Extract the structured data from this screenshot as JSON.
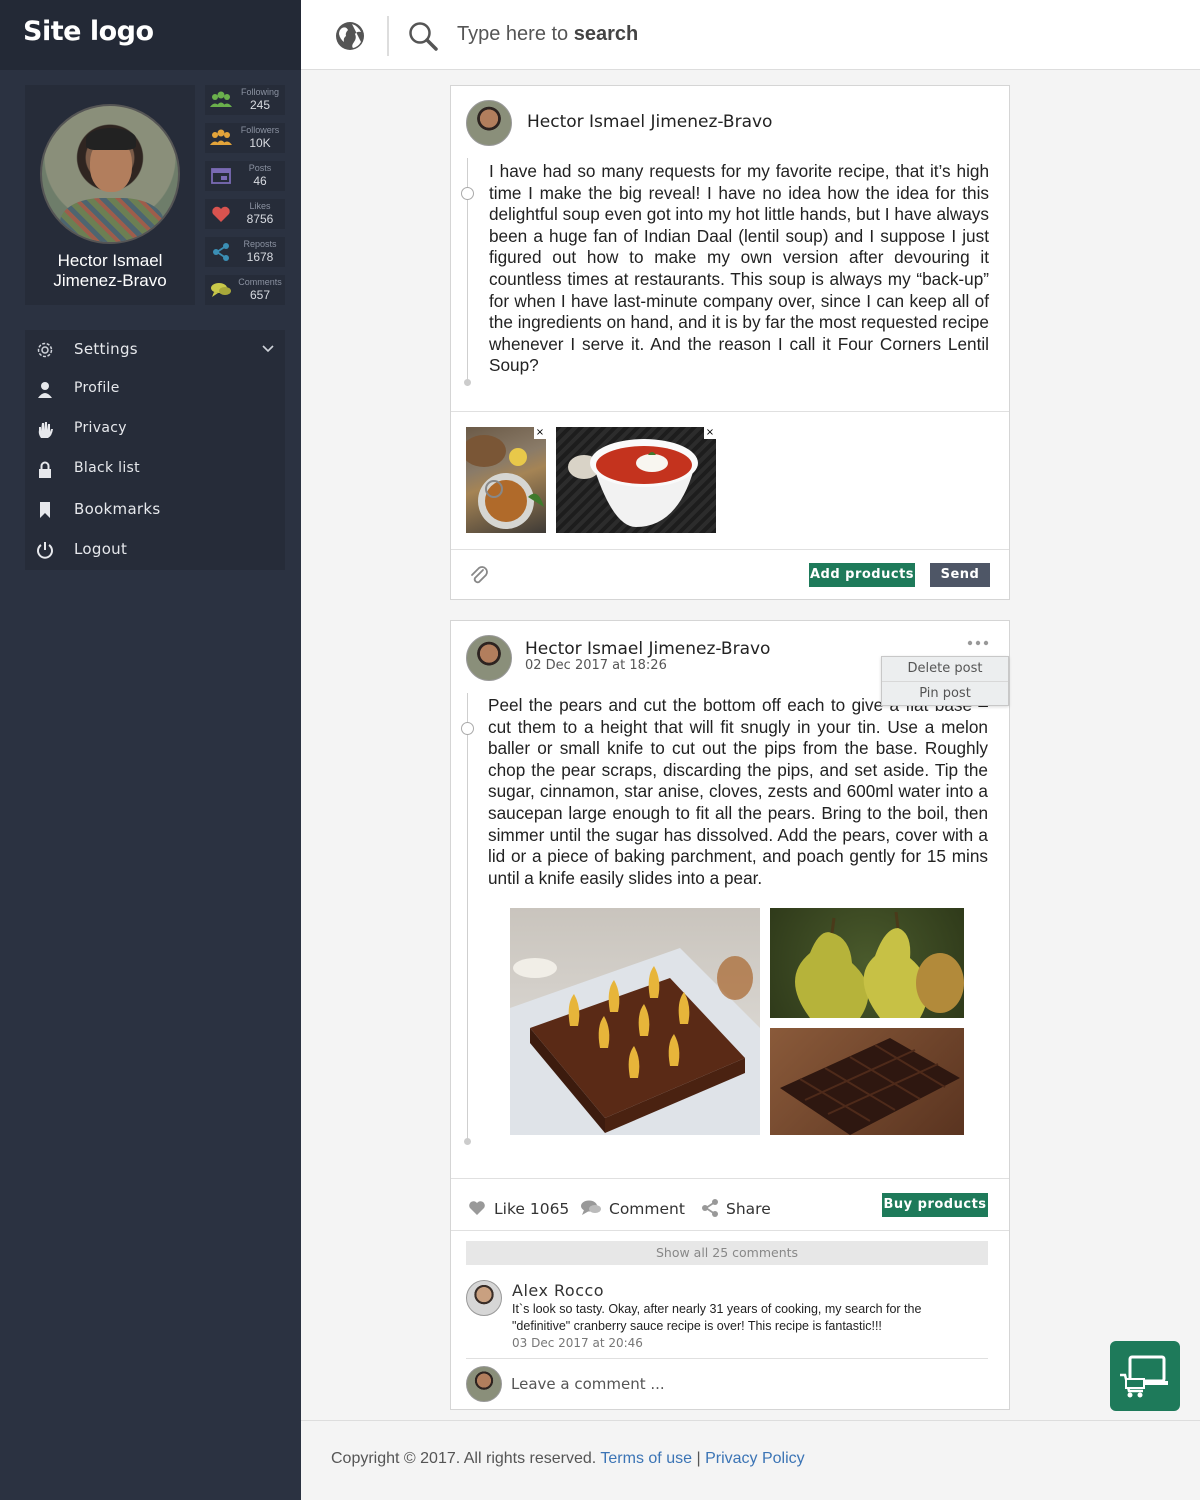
{
  "site": {
    "logo": "Site logo"
  },
  "profile": {
    "name": "Hector Ismael Jimenez-Bravo",
    "stats": [
      {
        "label": "Following",
        "value": "245",
        "icon": "following-icon",
        "color": "#6ab04c"
      },
      {
        "label": "Followers",
        "value": "10K",
        "icon": "followers-icon",
        "color": "#e3a43a"
      },
      {
        "label": "Posts",
        "value": "46",
        "icon": "posts-icon",
        "color": "#7a6bb5"
      },
      {
        "label": "Likes",
        "value": "8756",
        "icon": "heart-icon",
        "color": "#d9534f"
      },
      {
        "label": "Reposts",
        "value": "1678",
        "icon": "share-icon",
        "color": "#3b8fb5"
      },
      {
        "label": "Comments",
        "value": "657",
        "icon": "comments-icon",
        "color": "#c9c94a"
      }
    ]
  },
  "menu": {
    "settings": "Settings",
    "profile": "Profile",
    "privacy": "Privacy",
    "blacklist": "Black list",
    "bookmarks": "Bookmarks",
    "logout": "Logout"
  },
  "search": {
    "placeholder_prefix": "Type here to ",
    "placeholder_bold": "search"
  },
  "composer": {
    "author": "Hector Ismael Jimenez-Bravo",
    "text": "I have had so many requests for my favorite recipe, that it’s high time I make the big reveal! I have no idea how the idea for this delightful soup even got into my hot little hands, but I have always been a huge fan of Indian Daal (lentil soup) and I suppose I just figured out how to make my own version after devouring it countless times at restaurants. This soup is always my “back-up” for when I have last-minute company over, since I can keep all of the ingredients on hand, and it is by far the most requested recipe whenever I serve it. And the reason I call it Four Corners Lentil Soup?",
    "remove_label": "×",
    "add_products": "Add products",
    "send": "Send"
  },
  "post": {
    "author": "Hector Ismael Jimenez-Bravo",
    "date": "02 Dec 2017 at 18:26",
    "menu": [
      "Delete post",
      "Pin post"
    ],
    "text": "Peel the pears and cut the bottom off each to give a flat base – cut them to a height that will fit snugly in your tin. Use a melon baller or small knife to cut out the pips from the base. Roughly chop the pear scraps, discarding the pips, and set aside. Tip the sugar, cinnamon, star anise, cloves, zests and 600ml water into a saucepan large enough to fit all the pears. Bring to the boil, then simmer until the sugar has dissolved. Add the pears, cover with a lid or a piece of baking parchment, and poach gently for 15 mins until a knife easily slides into a pear.",
    "like_label": "Like",
    "like_count": "1065",
    "comment_label": "Comment",
    "share_label": "Share",
    "buy_products": "Buy products",
    "show_all": "Show all 25 comments",
    "comment": {
      "author": "Alex Rocco",
      "text": "It`s look so tasty. Okay, after nearly 31 years of cooking, my search for the \"definitive\" cranberry sauce recipe is over! This recipe is fantastic!!!",
      "date": "03 Dec 2017 at 20:46"
    },
    "leave_placeholder": "Leave a comment ..."
  },
  "footer": {
    "copyright": "Copyright © 2017. All rights reserved.",
    "terms": "Terms of use",
    "separator": "|",
    "privacy": "Privacy Policy"
  },
  "colors": {
    "sidebar": "#2b3241",
    "accent_green": "#1e7a5a",
    "link": "#3b74b5"
  }
}
